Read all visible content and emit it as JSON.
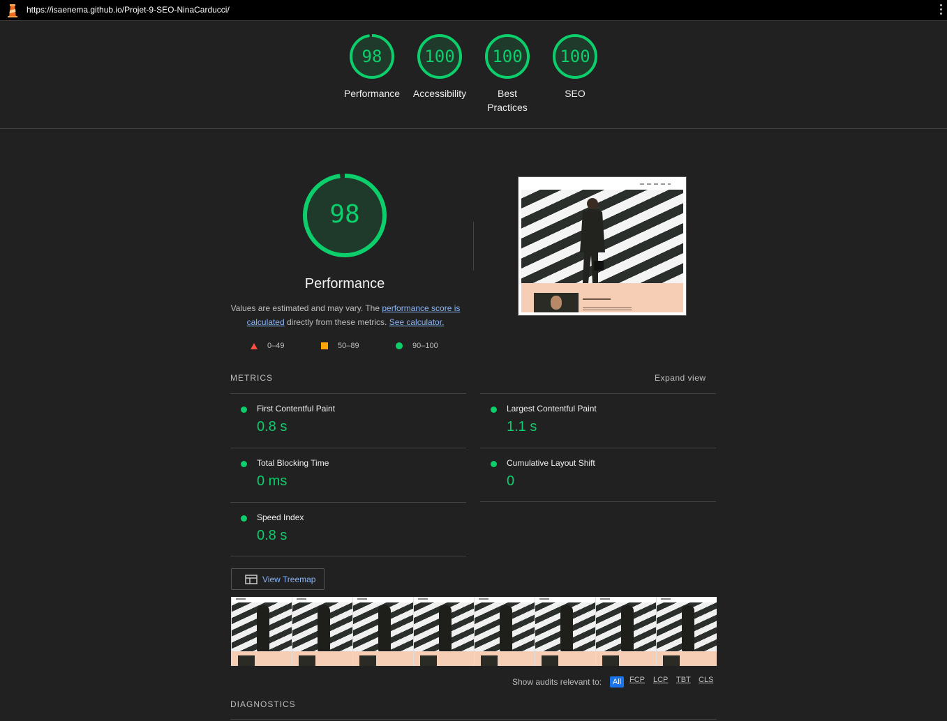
{
  "browser": {
    "url": "https://isaenema.github.io/Projet-9-SEO-NinaCarducci/"
  },
  "category_scores": [
    {
      "score": "98",
      "label": "Performance",
      "fraction": 0.98
    },
    {
      "score": "100",
      "label": "Accessibility",
      "fraction": 1.0
    },
    {
      "score": "100",
      "label": "Best Practices",
      "fraction": 1.0
    },
    {
      "score": "100",
      "label": "SEO",
      "fraction": 1.0
    }
  ],
  "performance": {
    "score": "98",
    "fraction": 0.98,
    "title": "Performance",
    "desc_pre": "Values are estimated and may vary. The ",
    "desc_link1": "performance score is calculated",
    "desc_mid": " directly from these metrics. ",
    "desc_link2": "See calculator.",
    "legend": {
      "fail": "0–49",
      "average": "50–89",
      "pass": "90–100"
    }
  },
  "colors": {
    "pass": "#0cce6b",
    "average": "#ffa400",
    "fail": "#ff4e42",
    "link": "#8ab4f8",
    "accent": "#1a73e8"
  },
  "metrics": {
    "header": "METRICS",
    "expand": "Expand view",
    "items": [
      {
        "name": "First Contentful Paint",
        "value": "0.8 s"
      },
      {
        "name": "Largest Contentful Paint",
        "value": "1.1 s"
      },
      {
        "name": "Total Blocking Time",
        "value": "0 ms"
      },
      {
        "name": "Cumulative Layout Shift",
        "value": "0"
      },
      {
        "name": "Speed Index",
        "value": "0.8 s"
      }
    ]
  },
  "treemap_label": "View Treemap",
  "filmstrip_frames": 8,
  "audit_filter": {
    "label": "Show audits relevant to:",
    "chips": [
      "All",
      "FCP",
      "LCP",
      "TBT",
      "CLS"
    ]
  },
  "diagnostics_header": "DIAGNOSTICS",
  "icons": [
    "lighthouse-icon",
    "more-vert-icon",
    "treemap-icon"
  ]
}
